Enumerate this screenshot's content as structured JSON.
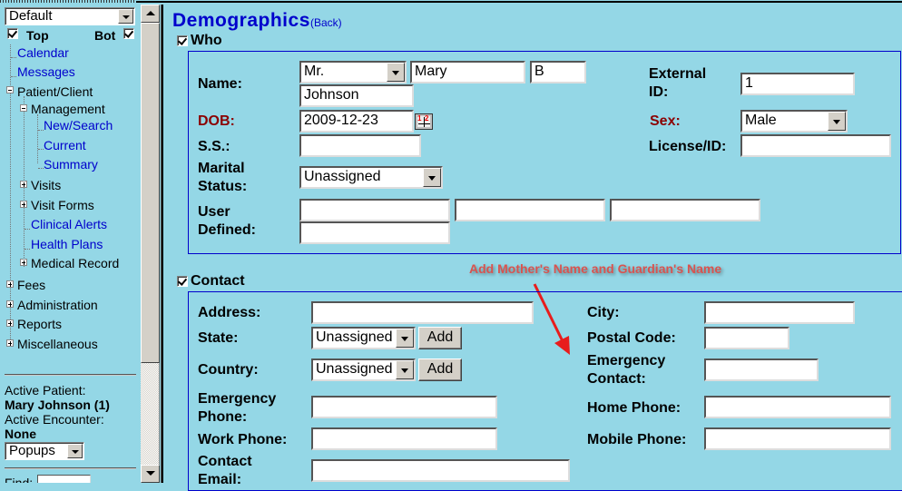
{
  "nav": {
    "view_select": "Default",
    "top_label": "Top",
    "bot_label": "Bot",
    "top_checked": true,
    "bot_checked": true,
    "items": [
      {
        "label": "Calendar",
        "type": "link"
      },
      {
        "label": "Messages",
        "type": "link"
      },
      {
        "label": "Patient/Client",
        "type": "folder",
        "expanded": true
      },
      {
        "label": "Management",
        "type": "folder",
        "expanded": true
      },
      {
        "label": "New/Search",
        "type": "link"
      },
      {
        "label": "Current",
        "type": "link"
      },
      {
        "label": "Summary",
        "type": "link"
      },
      {
        "label": "Visits",
        "type": "folder",
        "expanded": false
      },
      {
        "label": "Visit Forms",
        "type": "folder",
        "expanded": false
      },
      {
        "label": "Clinical Alerts",
        "type": "link"
      },
      {
        "label": "Health Plans",
        "type": "link"
      },
      {
        "label": "Medical Record",
        "type": "folder",
        "expanded": false
      },
      {
        "label": "Fees",
        "type": "folder",
        "expanded": false
      },
      {
        "label": "Administration",
        "type": "folder",
        "expanded": false
      },
      {
        "label": "Reports",
        "type": "folder",
        "expanded": false
      },
      {
        "label": "Miscellaneous",
        "type": "folder",
        "expanded": false
      }
    ],
    "active_patient_label": "Active Patient:",
    "active_patient_value": "Mary Johnson (1)",
    "active_encounter_label": "Active Encounter:",
    "active_encounter_value": "None",
    "popups_select": "Popups",
    "find_label": "Find:"
  },
  "page": {
    "title": "Demographics",
    "back_link": "(Back)"
  },
  "who": {
    "section_label": "Who",
    "checked": true,
    "name_label": "Name:",
    "title_select": "Mr.",
    "first_name": "Mary",
    "middle_name": "B",
    "last_name": "Johnson",
    "external_id_label": "External ID:",
    "external_id_line1": "External",
    "external_id_line2": "ID:",
    "external_id_value": "1",
    "dob_label": "DOB:",
    "dob_value": "2009-12-23",
    "sex_label": "Sex:",
    "sex_select": "Male",
    "ss_label": "S.S.:",
    "ss_value": "",
    "license_label": "License/ID:",
    "license_value": "",
    "marital_line1": "Marital",
    "marital_line2": "Status:",
    "marital_select": "Unassigned",
    "user_defined_line1": "User",
    "user_defined_line2": "Defined:",
    "user_defined_values": [
      "",
      "",
      "",
      ""
    ]
  },
  "annotation": {
    "text": "Add Mother's Name and Guardian's Name",
    "color": "#d9534f"
  },
  "contact": {
    "section_label": "Contact",
    "checked": true,
    "address_label": "Address:",
    "address_value": "",
    "state_label": "State:",
    "state_select": "Unassigned",
    "state_add": "Add",
    "country_label": "Country:",
    "country_select": "Unassigned",
    "country_add": "Add",
    "emergency_phone_line1": "Emergency",
    "emergency_phone_line2": "Phone:",
    "emergency_phone_value": "",
    "work_phone_label": "Work Phone:",
    "work_phone_value": "",
    "contact_email_line1": "Contact",
    "contact_email_line2": "Email:",
    "contact_email_value": "",
    "city_label": "City:",
    "city_value": "",
    "postal_label": "Postal Code:",
    "postal_value": "",
    "emergency_contact_line1": "Emergency",
    "emergency_contact_line2": "Contact:",
    "emergency_contact_value": "",
    "home_phone_label": "Home Phone:",
    "home_phone_value": "",
    "mobile_phone_label": "Mobile Phone:",
    "mobile_phone_value": ""
  }
}
